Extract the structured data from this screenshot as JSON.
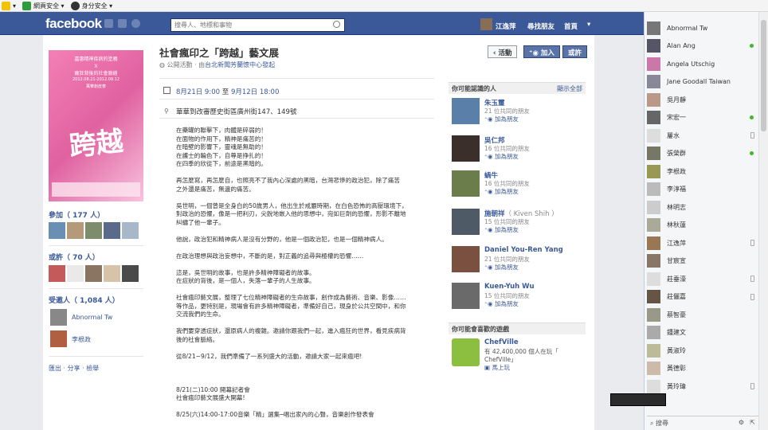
{
  "ie_toolbar": {
    "items": [
      "網頁安全",
      "身分安全"
    ]
  },
  "header": {
    "logo": "facebook",
    "search_placeholder": "搜尋人、地標和事物",
    "user_name": "江逸萍",
    "find_friends": "尋找朋友",
    "home": "首頁"
  },
  "event": {
    "title": "社會瘋印之「跨越」藝文展",
    "privacy": "公開活動",
    "host_prefix": "由",
    "host": "台北新聞芳蘭懷中心發起",
    "date_start": "8月21日 9:00",
    "date_sep": "至",
    "date_end": "9月12日 18:00",
    "location": "華華到改審歷史街區廣州街147、149號",
    "buttons": {
      "event": "活動",
      "join": "加入",
      "maybe": "或許"
    },
    "poster": {
      "line1": "嘉惠精神疾病的塗鴉",
      "line2": "Ｘ",
      "line3": "瘋狂背後的社會脈絡",
      "line4": "2012.08.21-2012.09.12",
      "line5": "萬華剝皮寮",
      "big": "跨越"
    }
  },
  "description": [
    "在藥罐的聯擊下，肉體是碎弱的！",
    "在面物的作用下，精神是痛苦的！",
    "在暗壁的影響下，靈魂是無助的！",
    "在護士的輪色下，自尊是挣扎的！",
    "在四季的欣從下，前途是黑暗的。",
    "",
    "再怎麼寫，再怎麼自，也照亮不了我內心深處的黑暗，台灣悲慘的政治犯，除了痛苦",
    "之外還是痛苦，無邊的痛苦。",
    "",
    "吳世明，一個曾是全身白的50歲男人，他出生於戒嚴時期，在白色恐怖的高壓環境下，",
    "對政治的恐懼，像是一把利刃，尖銳地嵌入他的思想中，宛如巨劑的恐懼，形影不離地",
    "糾纏了他一輩子。",
    "",
    "他說，政治犯和精神病人是沒有分野的，他是一個政治犯，也是一個精神病人。",
    "",
    "在政治理想與政治妄想中，不斷的是，對正義的追尋與極權的恐懼……",
    "",
    "這是，吳世明的故事，也是許多精神障礙者的故事。",
    "在症狀的背後，是一個人，失落一輩子的人生故事。",
    "",
    "社會瘋印藝文展，整理了七位精神障礙者的生命故事，創作成為藝術、音樂、影像……",
    "等作品，更特別是，現場會有許多精神障礙者，準備好自己，現身於公共空間中，和你",
    "交流我們的生命。",
    "",
    "我們要穿透症狀，還原病人的複雜。邀請你跟我們一起，進入瘋狂的世界，看見疾病背",
    "後的社會脈絡。",
    "",
    "從8/21~9/12，我們準備了一系列盛大的活動，邀請大家一起來瘋吧!",
    "",
    "",
    "",
    "8/21(二)10:00 開幕記者會",
    "社會瘋印藝文展盛大開幕!",
    "",
    "8/25(六)14:00-17:00音樂「精」選集─唱出家內的心聲，音樂創作發表會"
  ],
  "left": {
    "going_label": "參加",
    "going_count": "（ 177 人）",
    "maybe_label": "或許",
    "maybe_count": "（ 70 人）",
    "invited_label": "受邀人",
    "invited_count": "（ 1,084 人）",
    "invited_people": [
      "Abnormal Tw",
      "李根政"
    ],
    "actions": "匯出 · 分享 · 檢舉"
  },
  "pymk": {
    "header": "你可能認識的人",
    "see_all": "顯示全部",
    "people": [
      {
        "name": "朱玉璽",
        "mutual": "21 位共同的朋友",
        "add": "加為朋友"
      },
      {
        "name": "吳仁邦",
        "mutual": "16 位共同的朋友",
        "add": "加為朋友"
      },
      {
        "name": "蝸牛",
        "mutual": "16 位共同的朋友",
        "add": "加為朋友"
      },
      {
        "name": "施朝祥",
        "name_en": "（ Kiven Shih ）",
        "mutual": "15 位共同的朋友",
        "add": "加為朋友"
      },
      {
        "name": "Daniel You-Ren Yang",
        "mutual": "21 位共同的朋友",
        "add": "加為朋友"
      },
      {
        "name": "Kuen-Yuh Wu",
        "mutual": "15 位共同的朋友",
        "add": "加為朋友"
      }
    ]
  },
  "games": {
    "header": "你可能會喜歡的遊戲",
    "name": "ChefVille",
    "desc1": "有 42,400,000 個人在玩「",
    "desc2": "ChefVille」",
    "play": "馬上玩"
  },
  "chat": {
    "people": [
      {
        "name": "Abnormal Tw",
        "status": "none"
      },
      {
        "name": "Alan Ang",
        "status": "online"
      },
      {
        "name": "Angela Utschig",
        "status": "none"
      },
      {
        "name": "Jane Goodall Taiwan",
        "status": "none"
      },
      {
        "name": "吳月靜",
        "status": "none"
      },
      {
        "name": "宋宏一",
        "status": "online"
      },
      {
        "name": "屢水",
        "status": "mobile"
      },
      {
        "name": "張榮群",
        "status": "online"
      },
      {
        "name": "李根政",
        "status": "none"
      },
      {
        "name": "李淳福",
        "status": "none"
      },
      {
        "name": "林明志",
        "status": "none"
      },
      {
        "name": "林秋蓮",
        "status": "none"
      },
      {
        "name": "江逸萍",
        "status": "mobile"
      },
      {
        "name": "甘宸宣",
        "status": "none"
      },
      {
        "name": "莊垂濠",
        "status": "mobile"
      },
      {
        "name": "莊儷嘉",
        "status": "mobile"
      },
      {
        "name": "蔡智豪",
        "status": "none"
      },
      {
        "name": "鍾建文",
        "status": "none"
      },
      {
        "name": "黃淑玲",
        "status": "none"
      },
      {
        "name": "黃德彰",
        "status": "none"
      },
      {
        "name": "黃玲瑋",
        "status": "mobile"
      }
    ],
    "search": "搜尋"
  },
  "colors": {
    "fb_blue": "#3b5998",
    "link": "#3b5998",
    "online": "#42b72a"
  }
}
